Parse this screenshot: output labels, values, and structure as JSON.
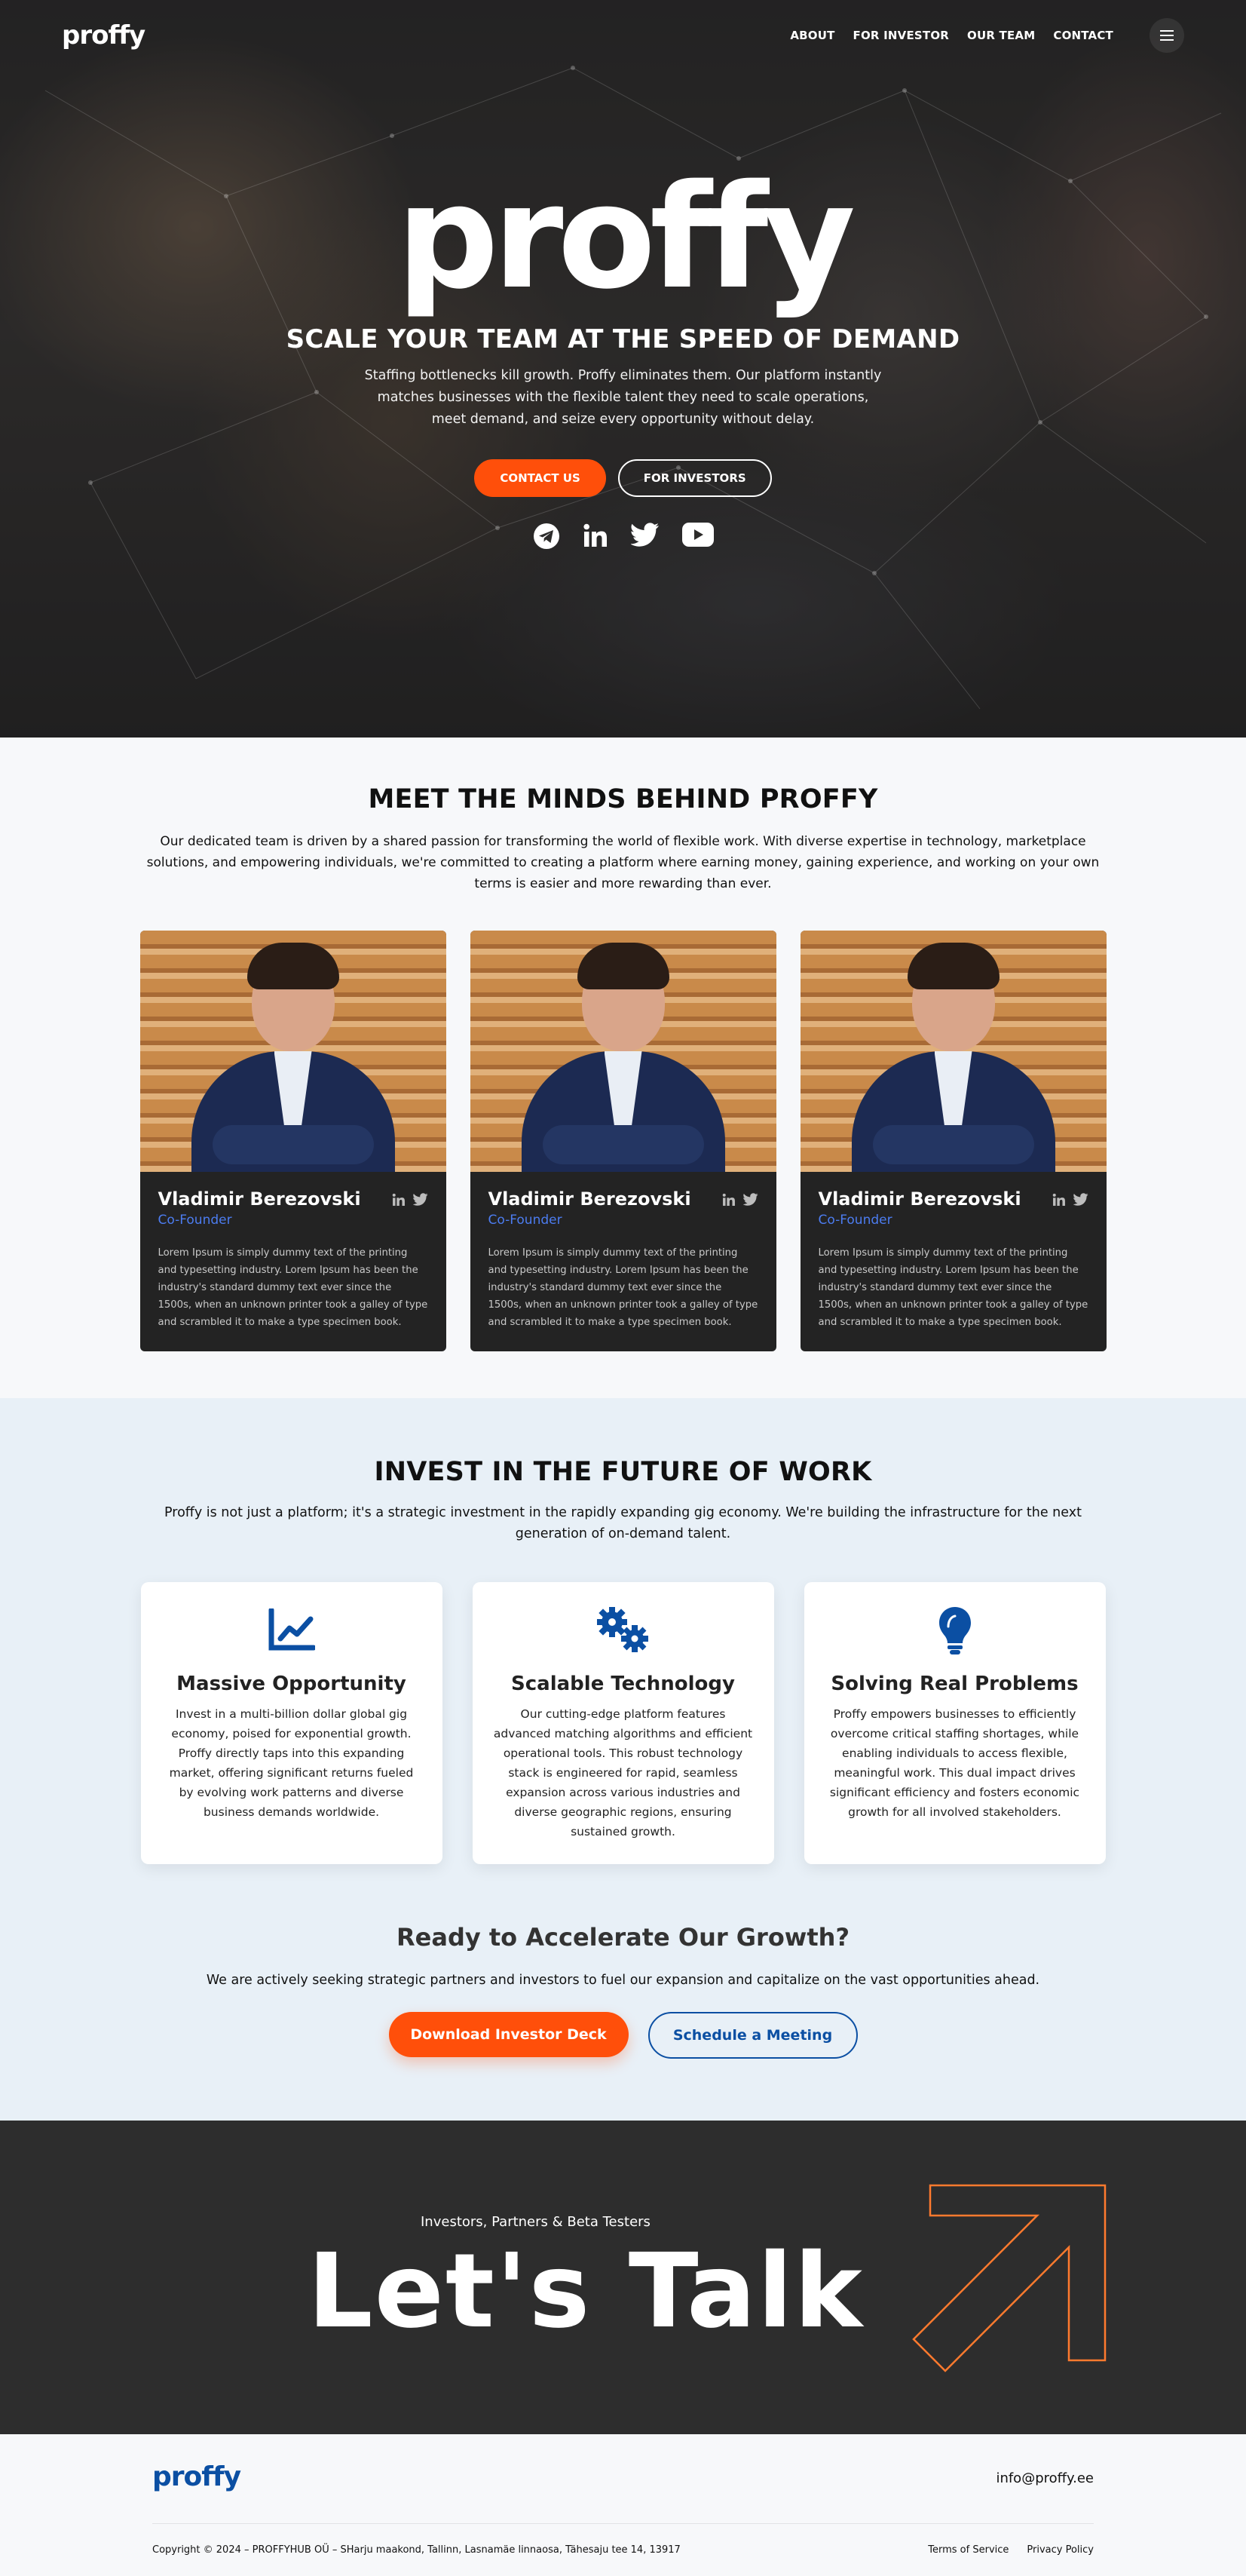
{
  "nav": {
    "logo": "proffy",
    "links": [
      "ABOUT",
      "FOR INVESTOR",
      "OUR TEAM",
      "CONTACT"
    ],
    "menu_icon": "hamburger-icon"
  },
  "hero": {
    "logo": "proffy",
    "title": "SCALE YOUR TEAM AT THE SPEED OF DEMAND",
    "lead": "Staffing bottlenecks kill growth. Proffy eliminates them. Our platform instantly matches businesses with the flexible talent they need to scale operations, meet demand, and seize every opportunity without delay.",
    "contact_label": "CONTACT US",
    "investors_label": "FOR INVESTORS",
    "accent": "#ff4f0a",
    "socials": [
      "telegram-icon",
      "linkedin-icon",
      "twitter-icon",
      "youtube-icon"
    ]
  },
  "team": {
    "title": "MEET THE MINDS BEHIND PROFFY",
    "intro": "Our dedicated team is driven by a shared passion for transforming the world of flexible work. With diverse expertise in technology, marketplace solutions, and empowering individuals, we're committed to creating a platform where earning money, gaining experience, and working on your own terms is easier and more rewarding than ever.",
    "members": [
      {
        "name": "Vladimir Berezovski",
        "role": "Co-Founder",
        "bio": "Lorem Ipsum is simply dummy text of the printing and typesetting industry. Lorem Ipsum has been the industry's standard dummy text ever since the 1500s, when an unknown printer took a galley of type and scrambled it to make a type specimen book."
      },
      {
        "name": "Vladimir Berezovski",
        "role": "Co-Founder",
        "bio": "Lorem Ipsum is simply dummy text of the printing and typesetting industry. Lorem Ipsum has been the industry's standard dummy text ever since the 1500s, when an unknown printer took a galley of type and scrambled it to make a type specimen book."
      },
      {
        "name": "Vladimir Berezovski",
        "role": "Co-Founder",
        "bio": "Lorem Ipsum is simply dummy text of the printing and typesetting industry. Lorem Ipsum has been the industry's standard dummy text ever since the 1500s, when an unknown printer took a galley of type and scrambled it to make a type specimen book."
      }
    ]
  },
  "invest": {
    "title": "INVEST IN THE FUTURE OF WORK",
    "intro": "Proffy is not just a platform; it's a strategic investment in the rapidly expanding gig economy. We're building the infrastructure for the next generation of on-demand talent.",
    "features": [
      {
        "icon": "chart-line-icon",
        "title": "Massive Opportunity",
        "text": "Invest in a multi-billion dollar global gig economy, poised for exponential growth. Proffy directly taps into this expanding market, offering significant returns fueled by evolving work patterns and diverse business demands worldwide."
      },
      {
        "icon": "gears-icon",
        "title": "Scalable Technology",
        "text": "Our cutting-edge platform features advanced matching algorithms and efficient operational tools. This robust technology stack is engineered for rapid, seamless expansion across various industries and diverse geographic regions, ensuring sustained growth."
      },
      {
        "icon": "lightbulb-icon",
        "title": "Solving Real Problems",
        "text": "Proffy empowers businesses to efficiently overcome critical staffing shortages, while enabling individuals to access flexible, meaningful work. This dual impact drives significant efficiency and fosters economic growth for all involved stakeholders."
      }
    ],
    "cta_title": "Ready to Accelerate Our Growth?",
    "cta_text": "We are actively seeking strategic partners and investors to fuel our expansion and capitalize on the vast opportunities ahead.",
    "download_label": "Download Investor Deck",
    "meeting_label": "Schedule a Meeting",
    "brand_blue": "#0b4fa3"
  },
  "talk": {
    "kicker": "Investors, Partners & Beta Testers",
    "headline": "Let's Talk"
  },
  "footer": {
    "logo": "proffy",
    "email": "info@proffy.ee",
    "copyright": "Copyright © 2024 – PROFFYHUB OÜ – SHarju maakond, Tallinn, Lasnamäe linnaosa, Tähesaju tee 14, 13917",
    "terms": "Terms of Service",
    "privacy": "Privacy Policy"
  }
}
